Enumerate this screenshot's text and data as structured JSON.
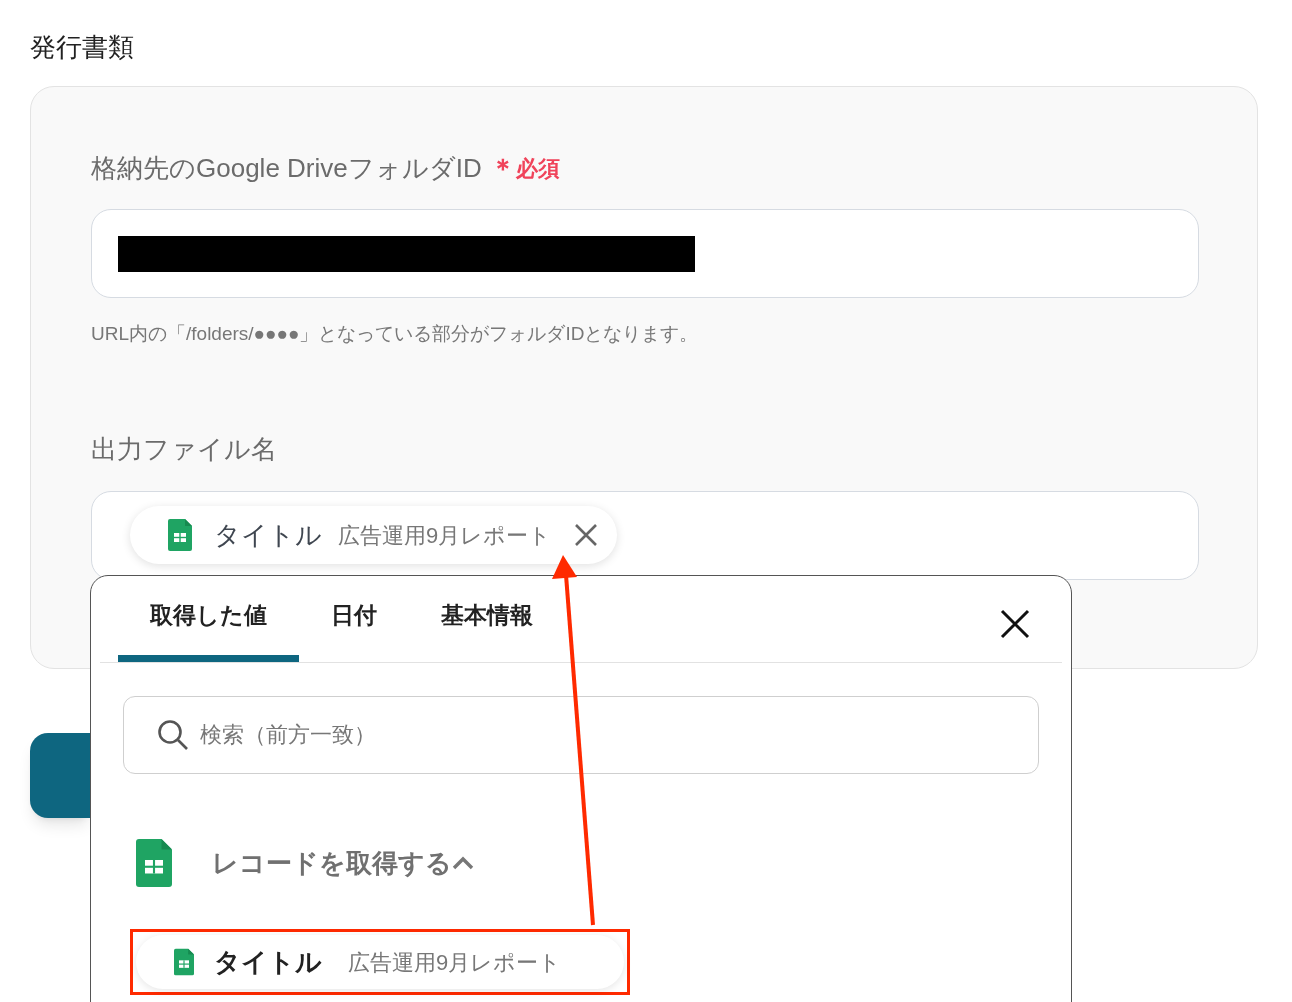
{
  "section_title": "発行書類",
  "fields": [
    {
      "label": "格納先のGoogle DriveフォルダID",
      "required_mark": "＊",
      "required_text": "必須",
      "value_redacted": true,
      "help": "URL内の「/folders/●●●●」となっている部分がフォルダIDとなります。"
    },
    {
      "label": "出力ファイル名",
      "tokens": [
        {
          "name": "タイトル",
          "value": "広告運用9月レポート"
        }
      ]
    }
  ],
  "picker": {
    "tabs": [
      {
        "label": "取得した値",
        "selected": true
      },
      {
        "label": "日付",
        "selected": false
      },
      {
        "label": "基本情報",
        "selected": false
      }
    ],
    "search": {
      "placeholder": "検索（前方一致）"
    },
    "group": {
      "title": "レコードを取得する",
      "expanded": true,
      "items": [
        {
          "name": "タイトル",
          "value": "広告運用9月レポート",
          "highlighted": true
        }
      ]
    }
  }
}
